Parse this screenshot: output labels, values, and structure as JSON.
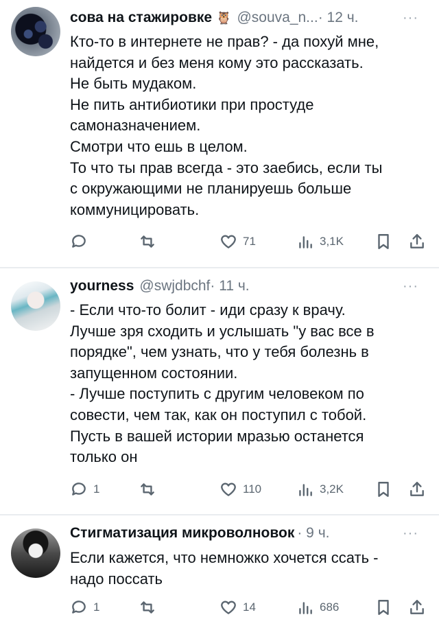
{
  "tweets": [
    {
      "name": "сова на стажировке",
      "handle": "@souva_n...",
      "time": "· 12 ч.",
      "more": "···",
      "text": "Кто-то в интернете не прав? - да похуй мне,\nнайдется и без меня кому это рассказать.\nНе быть мудаком.\nНе пить антибиотики при простуде\nсамоназначением.\nСмотри что ешь в целом.\nТо что ты прав всегда - это заебись, если ты\nс окружающими не планируешь больше\nкоммуницировать.",
      "replies": "",
      "likes": "71",
      "views": "3,1K"
    },
    {
      "name": "yourness",
      "handle": "@swjdbchf",
      "time": "· 11 ч.",
      "more": "···",
      "text": "- Если что-то болит - иди сразу к врачу.\nЛучше зря сходить и услышать \"у вас все в\nпорядке\", чем узнать, что у тебя болезнь в\nзапущенном состоянии.\n- Лучше поступить с другим человеком по\nсовести, чем так, как он поступил с тобой.\nПусть в вашей истории мразью останется\nтолько он",
      "replies": "1",
      "likes": "110",
      "views": "3,2K"
    },
    {
      "name": "Стигматизация микроволновок",
      "handle": "",
      "time": "· 9 ч.",
      "more": "···",
      "text": "Если кажется, что немножко хочется ссать -\nнадо поссать",
      "replies": "1",
      "likes": "14",
      "views": "686"
    }
  ],
  "icons": {
    "owl": "owl-emoji",
    "reply": "reply-icon",
    "retweet": "retweet-icon",
    "like": "heart-icon",
    "views": "views-icon",
    "bookmark": "bookmark-icon",
    "share": "share-icon"
  },
  "colors": {
    "text": "#0f1419",
    "secondary": "#6b7580",
    "separator": "#e9ecef"
  }
}
